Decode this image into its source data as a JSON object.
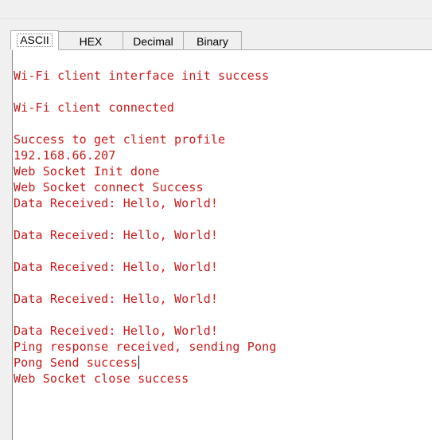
{
  "tabs": [
    {
      "label": "ASCII",
      "active": true
    },
    {
      "label": "HEX",
      "active": false
    },
    {
      "label": "Decimal",
      "active": false
    },
    {
      "label": "Binary",
      "active": false
    }
  ],
  "log_color": "#c81a1a",
  "log_lines": [
    "Wi-Fi client interface init success",
    "",
    "Wi-Fi client connected",
    "",
    "Success to get client profile",
    "192.168.66.207",
    "Web Socket Init done",
    "Web Socket connect Success",
    "Data Received: Hello, World!",
    "",
    "Data Received: Hello, World!",
    "",
    "Data Received: Hello, World!",
    "",
    "Data Received: Hello, World!",
    "",
    "Data Received: Hello, World!",
    "Ping response received, sending Pong",
    "Pong Send success",
    "Web Socket close success"
  ]
}
